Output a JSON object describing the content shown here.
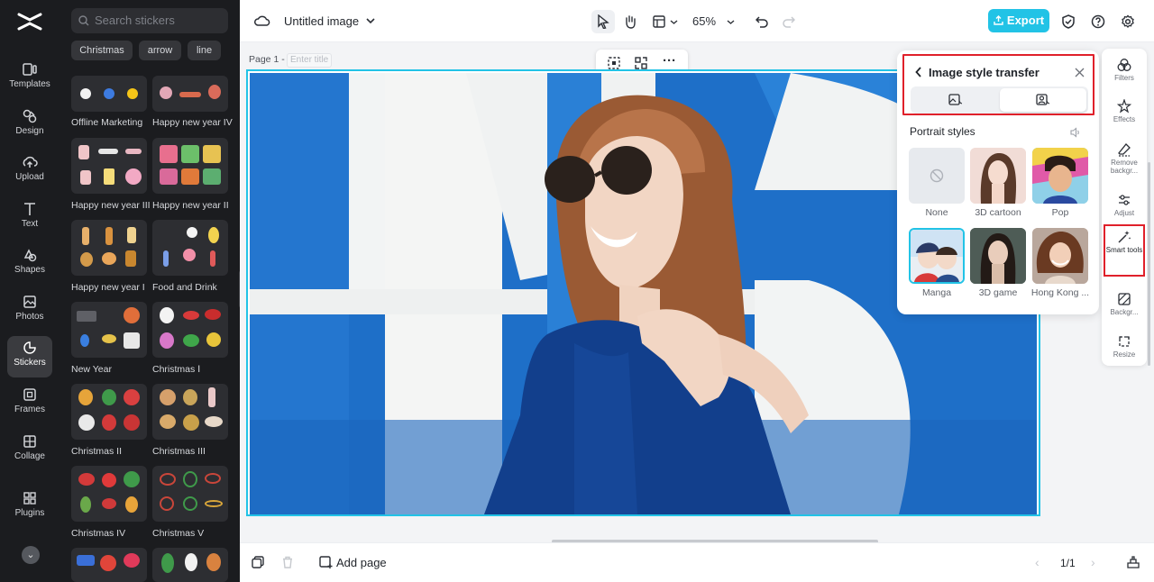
{
  "app": {
    "document_title": "Untitled image",
    "zoom": "65%",
    "export_label": "Export"
  },
  "leftnav": {
    "items": [
      {
        "label": "Templates",
        "icon": "templates-icon"
      },
      {
        "label": "Design",
        "icon": "design-icon"
      },
      {
        "label": "Upload",
        "icon": "upload-icon"
      },
      {
        "label": "Text",
        "icon": "text-icon"
      },
      {
        "label": "Shapes",
        "icon": "shapes-icon"
      },
      {
        "label": "Photos",
        "icon": "photos-icon"
      },
      {
        "label": "Stickers",
        "icon": "stickers-icon",
        "active": true
      },
      {
        "label": "Frames",
        "icon": "frames-icon"
      },
      {
        "label": "Collage",
        "icon": "collage-icon"
      },
      {
        "label": "Plugins",
        "icon": "plugins-icon"
      }
    ]
  },
  "stickers": {
    "search_placeholder": "Search stickers",
    "chips": [
      "Christmas",
      "arrow",
      "line"
    ],
    "groups": [
      {
        "name": "Offline Marketing"
      },
      {
        "name": "Happy new year IV"
      },
      {
        "name": "Happy new year III"
      },
      {
        "name": "Happy new year II"
      },
      {
        "name": "Happy new year I"
      },
      {
        "name": "Food and Drink"
      },
      {
        "name": "New Year"
      },
      {
        "name": "Christmas Ⅰ"
      },
      {
        "name": "Christmas II"
      },
      {
        "name": "Christmas III"
      },
      {
        "name": "Christmas IV"
      },
      {
        "name": "Christmas V"
      }
    ]
  },
  "canvas": {
    "page_label": "Page 1 -",
    "title_placeholder": "Enter title"
  },
  "bottom": {
    "add_page_label": "Add page",
    "pager": "1/1"
  },
  "style_transfer": {
    "title": "Image style transfer",
    "section": "Portrait styles",
    "styles": [
      {
        "name": "None"
      },
      {
        "name": "3D cartoon"
      },
      {
        "name": "Pop"
      },
      {
        "name": "Manga",
        "selected": true
      },
      {
        "name": "3D game"
      },
      {
        "name": "Hong Kong ..."
      }
    ]
  },
  "right_tools": [
    {
      "label": "Filters"
    },
    {
      "label": "Effects"
    },
    {
      "label": "Remove backgr..."
    },
    {
      "label": "Adjust"
    },
    {
      "label": "Smart tools",
      "highlighted": true
    },
    {
      "label": "Backgr..."
    },
    {
      "label": "Resize"
    }
  ],
  "colors": {
    "accent": "#22c3e6",
    "highlight_border": "#e0202a",
    "sidebar_bg": "#1b1c1f"
  }
}
